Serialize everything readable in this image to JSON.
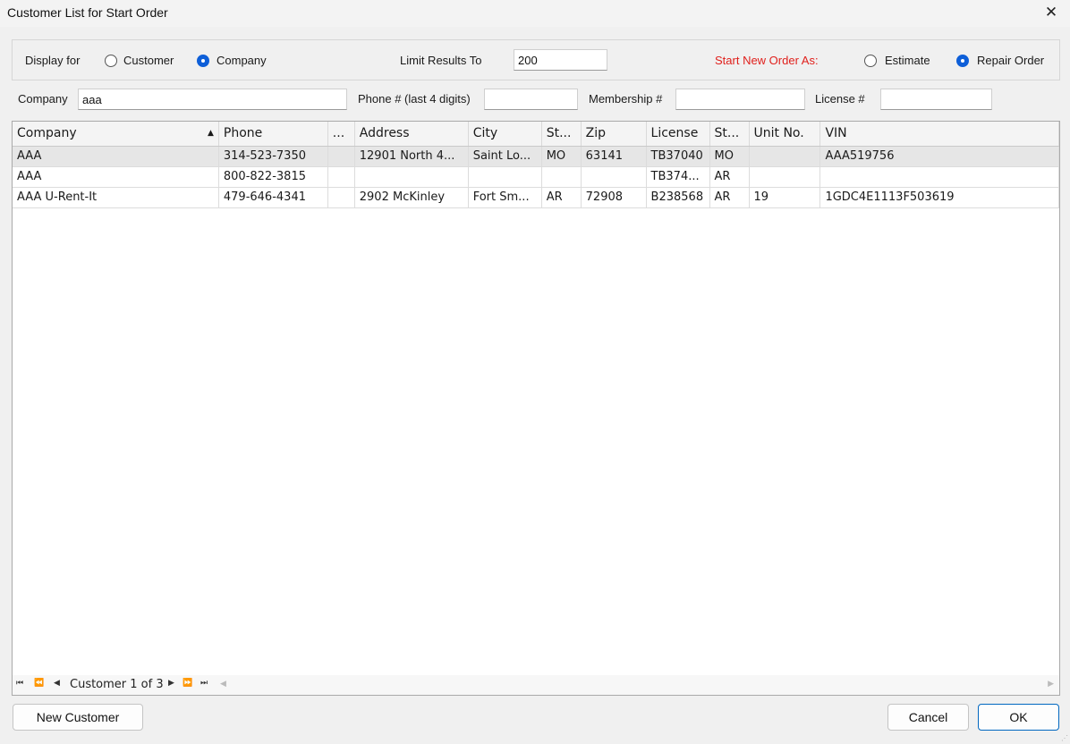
{
  "window": {
    "title": "Customer List for Start Order",
    "close_icon": "✕"
  },
  "filters": {
    "display_for_label": "Display for",
    "display_options": [
      {
        "label": "Customer",
        "selected": false
      },
      {
        "label": "Company",
        "selected": true
      }
    ],
    "limit_label": "Limit Results To",
    "limit_value": "200",
    "start_new_order_label": "Start New Order As:",
    "order_options": [
      {
        "label": "Estimate",
        "selected": false
      },
      {
        "label": "Repair Order",
        "selected": true
      }
    ]
  },
  "search": {
    "company_label": "Company",
    "company_value": "aaa",
    "phone_label": "Phone # (last 4 digits)",
    "phone_value": "",
    "membership_label": "Membership #",
    "membership_value": "",
    "license_label": "License #",
    "license_value": ""
  },
  "grid": {
    "columns": [
      "Company",
      "Phone",
      "...",
      "Address",
      "City",
      "St...",
      "Zip",
      "License",
      "St...",
      "Unit No.",
      "VIN"
    ],
    "sort_icon": "▲",
    "rows": [
      [
        "AAA",
        "314-523-7350",
        "",
        "12901 North 4...",
        "Saint Lo...",
        "MO",
        "63141",
        "TB37040",
        "MO",
        "",
        "AAA519756"
      ],
      [
        "AAA",
        "800-822-3815",
        "",
        "",
        "",
        "",
        "",
        "TB374...",
        "AR",
        "",
        ""
      ],
      [
        "AAA U-Rent-It",
        "479-646-4341",
        "",
        "2902 McKinley",
        "Fort Sm...",
        "AR",
        "72908",
        "B238568",
        "AR",
        "19",
        "1GDC4E1113F503619"
      ]
    ]
  },
  "navigator": {
    "text": "Customer 1 of 3",
    "first_icon": "⏮",
    "prev_page_icon": "⏪",
    "prev_icon": "◀",
    "next_icon": "▶",
    "next_page_icon": "⏩",
    "last_icon": "⏭"
  },
  "buttons": {
    "new_customer": "New Customer",
    "cancel": "Cancel",
    "ok": "OK"
  }
}
